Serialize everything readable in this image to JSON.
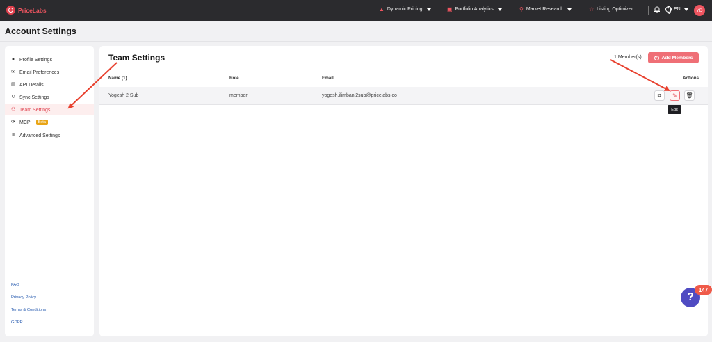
{
  "brand": {
    "name": "PriceLabs",
    "accent": "#ef5560"
  },
  "nav": {
    "items": [
      {
        "label": "Dynamic Pricing",
        "icon": "flame-icon"
      },
      {
        "label": "Portfolio Analytics",
        "icon": "chart-icon"
      },
      {
        "label": "Market Research",
        "icon": "search-icon"
      },
      {
        "label": "Listing Optimizer",
        "icon": "star-icon"
      }
    ],
    "language": "EN",
    "avatar_initials": "YD"
  },
  "page": {
    "title": "Account Settings"
  },
  "sidebar": {
    "items": [
      {
        "label": "Profile Settings",
        "icon": "user-icon"
      },
      {
        "label": "Email Preferences",
        "icon": "mail-icon"
      },
      {
        "label": "API Details",
        "icon": "api-icon"
      },
      {
        "label": "Sync Settings",
        "icon": "sync-icon"
      },
      {
        "label": "Team Settings",
        "icon": "team-icon",
        "active": true
      },
      {
        "label": "MCP",
        "icon": "mcp-icon",
        "badge": "Beta"
      },
      {
        "label": "Advanced Settings",
        "icon": "sliders-icon"
      }
    ],
    "footer_links": [
      "FAQ",
      "Privacy Policy",
      "Terms & Conditions",
      "GDPR"
    ]
  },
  "team": {
    "title": "Team Settings",
    "member_count": "1 Member(s)",
    "add_button": "Add Members",
    "columns": [
      "Name (1)",
      "Role",
      "Email",
      "Actions"
    ],
    "rows": [
      {
        "name": "Yogesh 2 Sub",
        "role": "member",
        "email": "yogesh.ilimbani2sub@pricelabs.co"
      }
    ],
    "tooltip": "Edit"
  },
  "help": {
    "badge_count": "147",
    "icon": "question-icon"
  }
}
